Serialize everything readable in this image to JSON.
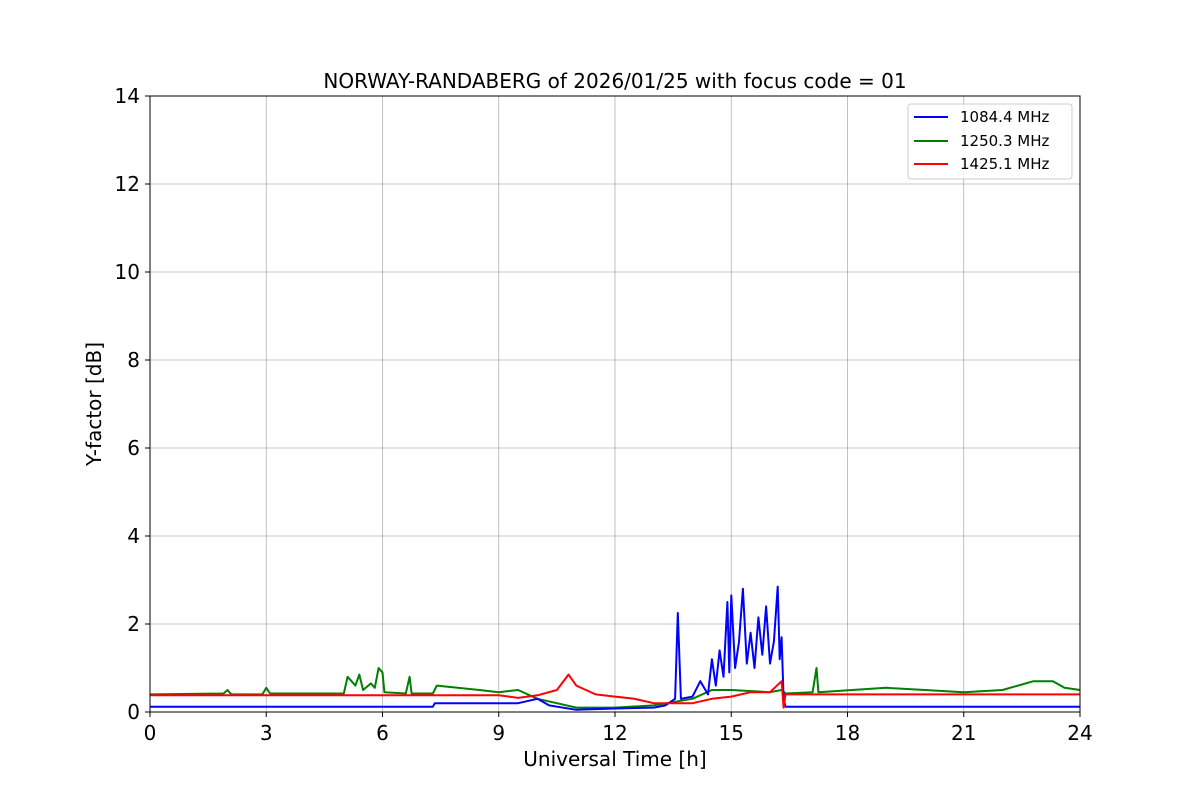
{
  "chart_data": {
    "type": "line",
    "title": "NORWAY-RANDABERG of 2026/01/25 with focus code = 01",
    "xlabel": "Universal Time [h]",
    "ylabel": "Y-factor [dB]",
    "xlim": [
      0,
      24
    ],
    "ylim": [
      0,
      14
    ],
    "xticks": [
      0,
      3,
      6,
      9,
      12,
      15,
      18,
      21,
      24
    ],
    "yticks": [
      0,
      2,
      4,
      6,
      8,
      10,
      12,
      14
    ],
    "xtick_labels": [
      "0",
      "3",
      "6",
      "9",
      "12",
      "15",
      "18",
      "21",
      "24"
    ],
    "ytick_labels": [
      "0",
      "2",
      "4",
      "6",
      "8",
      "10",
      "12",
      "14"
    ],
    "grid": true,
    "legend_position": "top-right",
    "series": [
      {
        "name": "1084.4 MHz",
        "color": "#0000ff",
        "points": [
          [
            0,
            0.12
          ],
          [
            7.3,
            0.12
          ],
          [
            7.35,
            0.2
          ],
          [
            8.5,
            0.2
          ],
          [
            9.5,
            0.2
          ],
          [
            10.0,
            0.3
          ],
          [
            10.3,
            0.15
          ],
          [
            11.0,
            0.05
          ],
          [
            12.0,
            0.08
          ],
          [
            13.0,
            0.1
          ],
          [
            13.3,
            0.15
          ],
          [
            13.55,
            0.3
          ],
          [
            13.62,
            2.25
          ],
          [
            13.7,
            0.3
          ],
          [
            14.0,
            0.35
          ],
          [
            14.2,
            0.7
          ],
          [
            14.4,
            0.4
          ],
          [
            14.5,
            1.2
          ],
          [
            14.6,
            0.6
          ],
          [
            14.7,
            1.4
          ],
          [
            14.8,
            0.8
          ],
          [
            14.9,
            2.5
          ],
          [
            14.95,
            0.9
          ],
          [
            15.0,
            2.65
          ],
          [
            15.1,
            1.0
          ],
          [
            15.2,
            1.6
          ],
          [
            15.3,
            2.8
          ],
          [
            15.4,
            1.1
          ],
          [
            15.5,
            1.8
          ],
          [
            15.6,
            1.0
          ],
          [
            15.7,
            2.15
          ],
          [
            15.8,
            1.3
          ],
          [
            15.9,
            2.4
          ],
          [
            16.0,
            1.1
          ],
          [
            16.1,
            1.6
          ],
          [
            16.2,
            2.85
          ],
          [
            16.25,
            1.2
          ],
          [
            16.3,
            1.7
          ],
          [
            16.35,
            0.3
          ],
          [
            16.4,
            0.12
          ],
          [
            24,
            0.12
          ]
        ]
      },
      {
        "name": "1250.3 MHz",
        "color": "#008000",
        "points": [
          [
            0,
            0.4
          ],
          [
            1.9,
            0.42
          ],
          [
            2.0,
            0.5
          ],
          [
            2.1,
            0.4
          ],
          [
            2.9,
            0.4
          ],
          [
            3.0,
            0.55
          ],
          [
            3.1,
            0.42
          ],
          [
            5.0,
            0.42
          ],
          [
            5.1,
            0.8
          ],
          [
            5.3,
            0.6
          ],
          [
            5.4,
            0.85
          ],
          [
            5.5,
            0.5
          ],
          [
            5.7,
            0.65
          ],
          [
            5.8,
            0.55
          ],
          [
            5.9,
            1.0
          ],
          [
            6.0,
            0.9
          ],
          [
            6.05,
            0.45
          ],
          [
            6.6,
            0.42
          ],
          [
            6.7,
            0.8
          ],
          [
            6.75,
            0.42
          ],
          [
            7.3,
            0.42
          ],
          [
            7.4,
            0.6
          ],
          [
            8.5,
            0.5
          ],
          [
            9.0,
            0.45
          ],
          [
            9.5,
            0.5
          ],
          [
            10.0,
            0.3
          ],
          [
            10.5,
            0.2
          ],
          [
            11.0,
            0.1
          ],
          [
            12.0,
            0.1
          ],
          [
            13.0,
            0.15
          ],
          [
            14.0,
            0.3
          ],
          [
            14.5,
            0.5
          ],
          [
            15.0,
            0.5
          ],
          [
            16.0,
            0.45
          ],
          [
            16.3,
            0.5
          ],
          [
            16.4,
            0.42
          ],
          [
            17.1,
            0.45
          ],
          [
            17.2,
            1.0
          ],
          [
            17.25,
            0.45
          ],
          [
            19.0,
            0.55
          ],
          [
            20.0,
            0.5
          ],
          [
            21.0,
            0.45
          ],
          [
            22.0,
            0.5
          ],
          [
            22.8,
            0.7
          ],
          [
            23.3,
            0.7
          ],
          [
            23.6,
            0.55
          ],
          [
            24,
            0.5
          ]
        ]
      },
      {
        "name": "1425.1 MHz",
        "color": "#ff0000",
        "points": [
          [
            0,
            0.38
          ],
          [
            9.0,
            0.38
          ],
          [
            9.5,
            0.32
          ],
          [
            10.0,
            0.38
          ],
          [
            10.5,
            0.5
          ],
          [
            10.8,
            0.85
          ],
          [
            11.0,
            0.6
          ],
          [
            11.5,
            0.4
          ],
          [
            12.0,
            0.35
          ],
          [
            12.5,
            0.3
          ],
          [
            13.0,
            0.2
          ],
          [
            13.5,
            0.2
          ],
          [
            14.0,
            0.2
          ],
          [
            14.5,
            0.3
          ],
          [
            15.0,
            0.35
          ],
          [
            15.5,
            0.45
          ],
          [
            16.0,
            0.45
          ],
          [
            16.3,
            0.7
          ],
          [
            16.35,
            0.1
          ],
          [
            16.4,
            0.4
          ],
          [
            24,
            0.4
          ]
        ]
      }
    ]
  }
}
